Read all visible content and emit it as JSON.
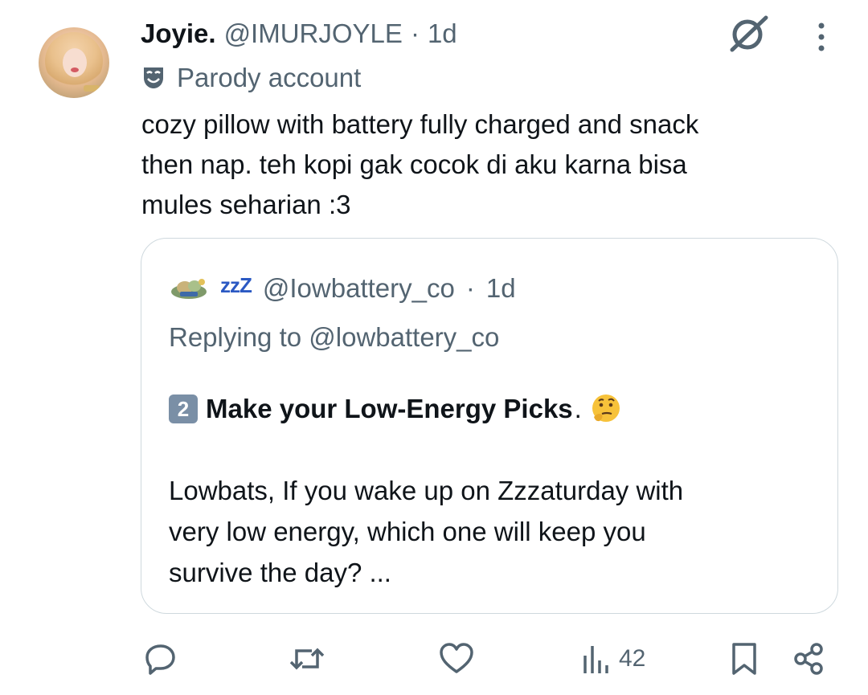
{
  "post": {
    "author_name": "Joyie.",
    "handle": "@IMURJOYLE",
    "separator": "·",
    "time": "1d",
    "badge_label": "Parody account",
    "text_lines": [
      "cozy pillow with battery fully charged and snack",
      "then nap. teh kopi gak cocok di aku karna bisa",
      "mules seharian :3"
    ]
  },
  "quote": {
    "zzz": "zzZ",
    "handle": "@Iowbattery_co",
    "separator": "·",
    "time": "1d",
    "replying_to": "Replying to @lowbattery_co",
    "keycap": "2",
    "headline_bold": "Make your Low-Energy Picks",
    "headline_suffix": ".",
    "body_lines": [
      "Lowbats, If you wake up on Zzzaturday with",
      "very low energy, which one will keep you",
      "survive the day? ..."
    ]
  },
  "actions": {
    "views_count": "42",
    "icons": [
      "reply-icon",
      "repost-icon",
      "like-icon",
      "views-icon",
      "bookmark-icon",
      "share-icon"
    ]
  },
  "colors": {
    "text": "#0f1419",
    "muted": "#536471",
    "border": "#cfd9de",
    "zzz": "#2b59c3"
  }
}
